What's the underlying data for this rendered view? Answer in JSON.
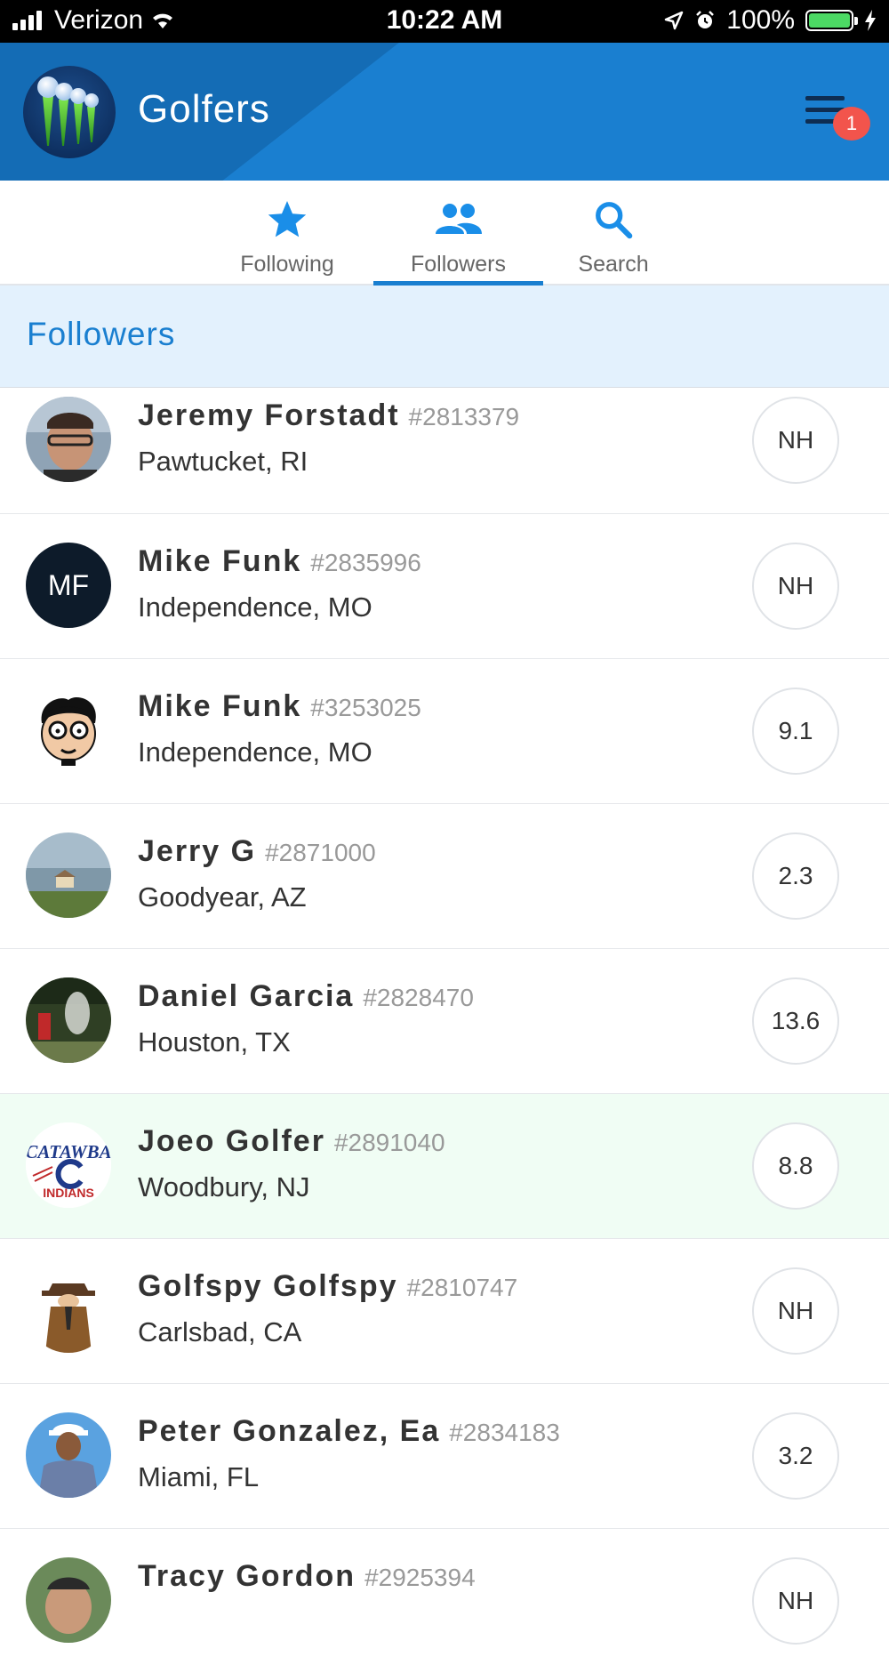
{
  "status_bar": {
    "carrier": "Verizon",
    "time": "10:22 AM",
    "battery": "100%"
  },
  "header": {
    "title": "Golfers",
    "notification_count": "1"
  },
  "tabs": [
    {
      "label": "Following",
      "icon": "star-icon"
    },
    {
      "label": "Followers",
      "icon": "people-icon"
    },
    {
      "label": "Search",
      "icon": "search-icon"
    }
  ],
  "active_tab": "Followers",
  "section": {
    "title": "Followers"
  },
  "golfers": [
    {
      "name": "Jeremy Forstadt",
      "id": "#2813379",
      "location": "Pawtucket, RI",
      "handicap": "NH",
      "avatar": "photo"
    },
    {
      "name": "Mike Funk",
      "id": "#2835996",
      "location": "Independence, MO",
      "handicap": "NH",
      "avatar": "initials",
      "initials": "MF"
    },
    {
      "name": "Mike Funk",
      "id": "#3253025",
      "location": "Independence, MO",
      "handicap": "9.1",
      "avatar": "cartoon"
    },
    {
      "name": "Jerry G",
      "id": "#2871000",
      "location": "Goodyear, AZ",
      "handicap": "2.3",
      "avatar": "landscape"
    },
    {
      "name": "Daniel Garcia",
      "id": "#2828470",
      "location": "Houston, TX",
      "handicap": "13.6",
      "avatar": "golf-photo"
    },
    {
      "name": "Joeo Golfer",
      "id": "#2891040",
      "location": "Woodbury, NJ",
      "handicap": "8.8",
      "avatar": "logo",
      "logo_text_top": "CATAWBA",
      "logo_text_bottom": "INDIANS",
      "highlighted": true
    },
    {
      "name": "Golfspy Golfspy",
      "id": "#2810747",
      "location": "Carlsbad, CA",
      "handicap": "NH",
      "avatar": "spy"
    },
    {
      "name": "Peter Gonzalez, Ea",
      "id": "#2834183",
      "location": "Miami, FL",
      "handicap": "3.2",
      "avatar": "golfer"
    },
    {
      "name": "Tracy Gordon",
      "id": "#2925394",
      "location": "",
      "handicap": "NH",
      "avatar": "photo2"
    }
  ],
  "colors": {
    "brand_blue": "#1a7fd0",
    "header_dark": "#146cb5",
    "badge_red": "#f2544c",
    "highlight_row": "#f0fdf4",
    "section_bg": "#e3f1fd"
  }
}
